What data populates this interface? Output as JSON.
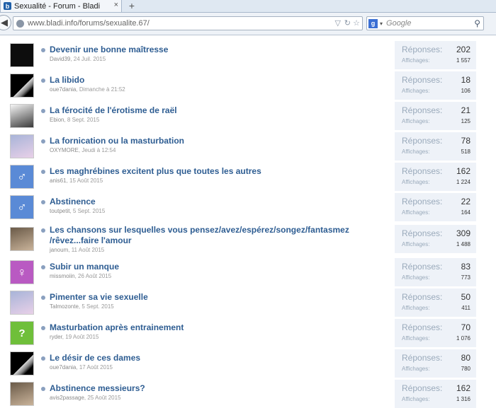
{
  "browser": {
    "tab_title": "Sexualité - Forum - Bladi",
    "favicon": "b",
    "tab_close": "×",
    "new_tab": "+",
    "url": "www.bladi.info/forums/sexualite.67/",
    "search_engine_icon": "g",
    "search_placeholder": "Google"
  },
  "labels": {
    "replies": "Réponses:",
    "views": "Affichages:"
  },
  "threads": [
    {
      "title": "Devenir une bonne maîtresse",
      "author": "David39",
      "date": "24 Juil. 2015",
      "replies": "202",
      "views": "1 557",
      "avatar": "black-dark"
    },
    {
      "title": "La libido",
      "author": "oue7dania",
      "date": "Dimanche à 21:52",
      "replies": "18",
      "views": "106",
      "avatar": "black-photo"
    },
    {
      "title": "La férocité de l'érotisme de raël",
      "author": "Ebion",
      "date": "8 Sept. 2015",
      "replies": "21",
      "views": "125",
      "avatar": "photo"
    },
    {
      "title": "La fornication ou la masturbation",
      "author": "OXYMORE",
      "date": "Jeudi à 12:54",
      "replies": "78",
      "views": "518",
      "avatar": "photo"
    },
    {
      "title": "Les maghrébines excitent plus que toutes les autres",
      "author": "anis61",
      "date": "15 Août 2015",
      "replies": "162",
      "views": "1 224",
      "avatar": "male-icon"
    },
    {
      "title": "Abstinence",
      "author": "toutpetit",
      "date": "5 Sept. 2015",
      "replies": "22",
      "views": "164",
      "avatar": "male-icon"
    },
    {
      "title": "Les chansons sur lesquelles vous pensez/avez/espérez/songez/fantasmez",
      "title2": "/rêvez...faire l'amour",
      "author": "janoum",
      "date": "11 Août 2015",
      "replies": "309",
      "views": "1 488",
      "avatar": "photo"
    },
    {
      "title": "Subir un manque",
      "author": "missmoiin",
      "date": "26 Août 2015",
      "replies": "83",
      "views": "773",
      "avatar": "female-icon"
    },
    {
      "title": "Pimenter sa vie sexuelle",
      "author": "Talmozonte",
      "date": "5 Sept. 2015",
      "replies": "50",
      "views": "411",
      "avatar": "photo"
    },
    {
      "title": "Masturbation après entrainement",
      "author": "ryder",
      "date": "19 Août 2015",
      "replies": "70",
      "views": "1 076",
      "avatar": "question-icon"
    },
    {
      "title": "Le désir de ces dames",
      "author": "oue7dania",
      "date": "17 Août 2015",
      "replies": "80",
      "views": "780",
      "avatar": "black-photo"
    },
    {
      "title": "Abstinence messieurs?",
      "author": "avis2passage",
      "date": "25 Août 2015",
      "replies": "162",
      "views": "1 316",
      "avatar": "photo"
    }
  ]
}
